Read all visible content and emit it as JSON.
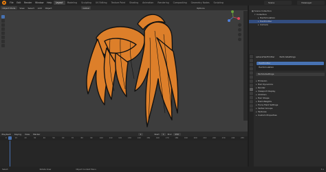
{
  "menu": [
    "File",
    "Edit",
    "Render",
    "Window",
    "Help"
  ],
  "workspaces": [
    "Layout",
    "Modeling",
    "Sculpting",
    "UV Editing",
    "Texture Paint",
    "Shading",
    "Animation",
    "Rendering",
    "Compositing",
    "Geometry Nodes",
    "Scripting"
  ],
  "active_workspace": "Layout",
  "scene": "Scene",
  "view_layer": "ViewLayer",
  "viewport": {
    "mode": "Object Mode",
    "menus": [
      "View",
      "Select",
      "Add",
      "Object"
    ],
    "transform": "Global",
    "tools": [
      "Options"
    ]
  },
  "timeline": {
    "menus": [
      "Playback",
      "Keying",
      "View",
      "Marker"
    ],
    "current_frame": "1",
    "start_label": "Start",
    "start": "1",
    "end_label": "End",
    "end": "250",
    "ticks": [
      "0",
      "10",
      "20",
      "30",
      "40",
      "50",
      "60",
      "70",
      "80",
      "90",
      "100",
      "110",
      "120",
      "130",
      "140",
      "150",
      "160",
      "170",
      "180",
      "190",
      "200",
      "210",
      "220",
      "230",
      "240",
      "250"
    ]
  },
  "status": {
    "left": "Select",
    "mid1": "Rotate View",
    "mid2": "Object Context Menu",
    "version": "3.x"
  },
  "outliner": {
    "rows": [
      "Scene Collection",
      "Collection",
      "HairSimulation",
      "HairEmitter",
      "Camera"
    ]
  },
  "properties": {
    "object_name": "sphereHairEmitter",
    "tab_name": "ParticleSettings",
    "system_name": "HairEmitter",
    "slot": "HairSimulation",
    "settings_name": "ParticleSettings",
    "sections": [
      "Emission",
      "Hair Dynamics",
      "Render",
      "Viewport Display",
      "Children",
      "Hair Shape",
      "Field Weights",
      "Force Field Settings",
      "Vertex Groups",
      "Textures",
      "Custom Properties"
    ]
  },
  "colors": {
    "hair_fill": "#dd7f2a",
    "hair_outline": "#111111",
    "accent": "#4772b3",
    "viewport_bg": "#3d3d3d"
  }
}
